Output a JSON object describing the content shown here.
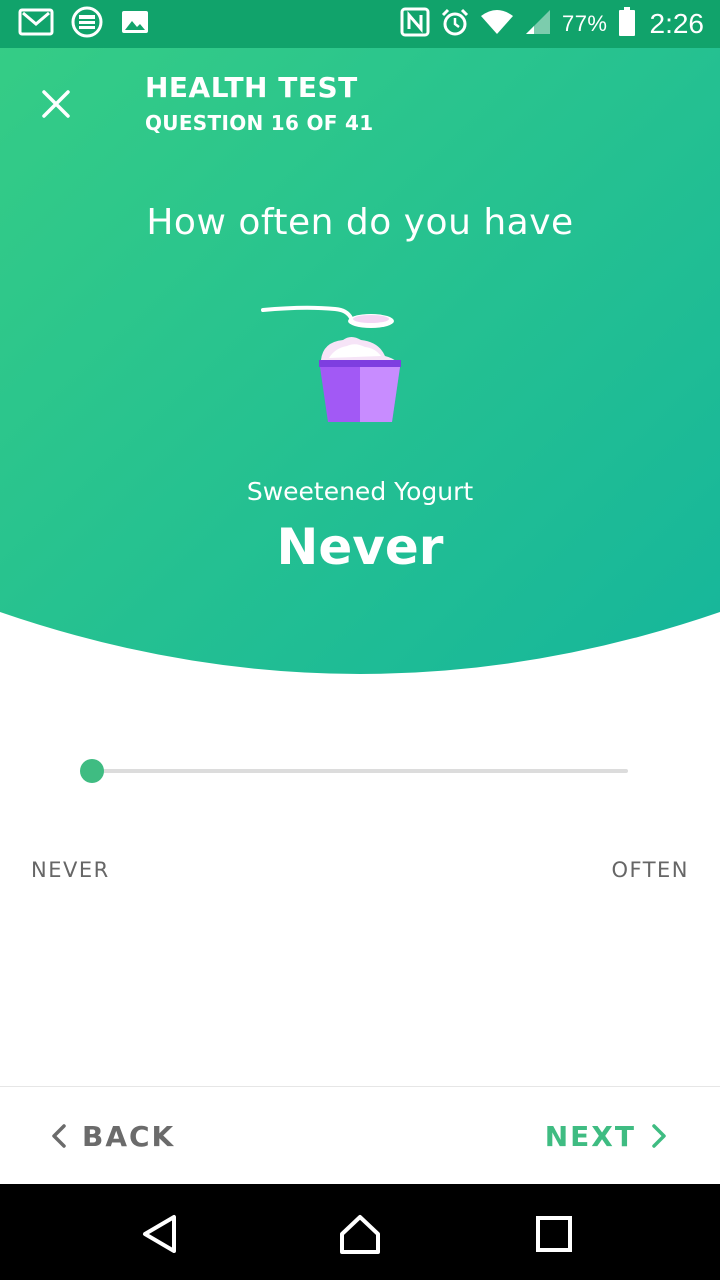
{
  "status_bar": {
    "battery_percent": "77%",
    "time": "2:26",
    "left_icons": [
      "gmail-icon",
      "stack-exchange-icon",
      "gallery-icon"
    ],
    "right_icons": [
      "nfc-icon",
      "alarm-icon",
      "wifi-icon",
      "signal-icon",
      "battery-icon"
    ]
  },
  "header": {
    "title": "HEALTH TEST",
    "progress": "QUESTION 16 OF 41",
    "close_icon": "close-icon"
  },
  "question": {
    "prompt": "How often do you have",
    "food_name": "Sweetened Yogurt",
    "food_icon": "yogurt-cup-icon",
    "answer": "Never"
  },
  "slider": {
    "min_label": "NEVER",
    "max_label": "OFTEN",
    "value": 0
  },
  "nav": {
    "back_label": "BACK",
    "next_label": "NEXT"
  },
  "colors": {
    "header_gradient_start": "#35cc86",
    "header_gradient_end": "#17b79a",
    "accent": "#3fbc82",
    "status_bar": "#11a36b",
    "yogurt_cup": "#a259f5",
    "nav_label_gray": "#6b6b6b"
  }
}
